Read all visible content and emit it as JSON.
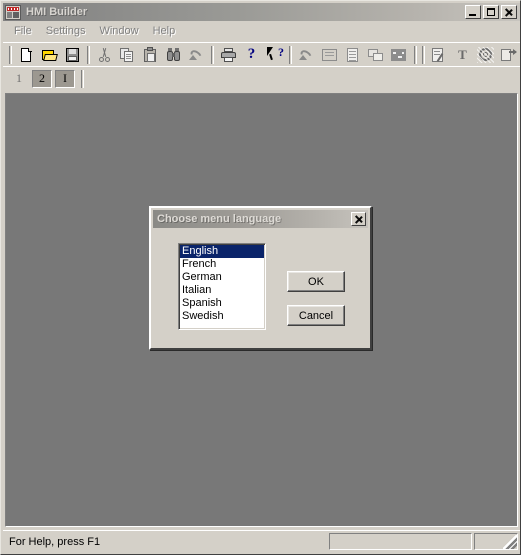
{
  "window": {
    "title": "HMI Builder",
    "icon": "hmi-builder-app-icon",
    "controls": {
      "minimize": "minimize-button",
      "maximize": "maximize-button",
      "close": "close-button"
    }
  },
  "menubar": {
    "items": [
      {
        "label": "File"
      },
      {
        "label": "Settings"
      },
      {
        "label": "Window"
      },
      {
        "label": "Help"
      }
    ]
  },
  "toolbar": {
    "groups": [
      {
        "buttons": [
          {
            "icon": "new-document-icon",
            "name": "new-button"
          },
          {
            "icon": "open-folder-icon",
            "name": "open-button"
          },
          {
            "icon": "save-floppy-icon",
            "name": "save-button"
          }
        ]
      },
      {
        "buttons": [
          {
            "icon": "scissors-icon",
            "name": "cut-button"
          },
          {
            "icon": "copy-icon",
            "name": "copy-button"
          },
          {
            "icon": "paste-clipboard-icon",
            "name": "paste-button"
          },
          {
            "icon": "binoculars-find-icon",
            "name": "find-button"
          },
          {
            "icon": "undo-arrow-icon",
            "name": "undo-button"
          }
        ]
      },
      {
        "buttons": [
          {
            "icon": "printer-icon",
            "name": "print-button"
          },
          {
            "icon": "question-mark-icon",
            "name": "help-button"
          },
          {
            "icon": "arrow-question-icon",
            "name": "context-help-button"
          }
        ]
      },
      {
        "buttons": [
          {
            "icon": "connect-nodes-icon",
            "name": "link-button"
          },
          {
            "icon": "new-frame-icon",
            "name": "new-frame-button"
          },
          {
            "icon": "document-lines-icon",
            "name": "block-list-button"
          },
          {
            "icon": "cascade-windows-icon",
            "name": "window-arrange-button"
          },
          {
            "icon": "bitmap-image-icon",
            "name": "image-button"
          }
        ]
      },
      {
        "buttons": [
          {
            "icon": "edit-note-icon",
            "name": "edit-note-button"
          },
          {
            "icon": "text-tool-icon",
            "name": "text-tool-button"
          },
          {
            "icon": "gear-settings-icon",
            "name": "settings-button"
          },
          {
            "icon": "export-icon",
            "name": "export-button"
          },
          {
            "icon": "import-icon",
            "name": "import-button"
          }
        ]
      }
    ]
  },
  "modebar": {
    "buttons": [
      {
        "label": "1",
        "state": "flat",
        "name": "mode-button-1"
      },
      {
        "label": "2",
        "state": "pressed",
        "name": "mode-button-2"
      },
      {
        "label": "I",
        "state": "pressed",
        "name": "mode-button-text"
      }
    ]
  },
  "dialog": {
    "title": "Choose menu language",
    "close_icon": "close-icon",
    "listbox": {
      "name": "language-listbox",
      "options": [
        {
          "label": "English",
          "selected": true
        },
        {
          "label": "French",
          "selected": false
        },
        {
          "label": "German",
          "selected": false
        },
        {
          "label": "Italian",
          "selected": false
        },
        {
          "label": "Spanish",
          "selected": false
        },
        {
          "label": "Swedish",
          "selected": false
        }
      ],
      "selected_value": "English"
    },
    "ok_label": "OK",
    "cancel_label": "Cancel"
  },
  "statusbar": {
    "text": "For Help, press F1",
    "pane1": "",
    "pane2": ""
  },
  "colors": {
    "face": "#d4d0c8",
    "workspace": "#787878",
    "selection": "#0a246a",
    "title_gradient_start": "#808080",
    "title_gradient_end": "#c8c5bf",
    "folder_yellow": "#ffd700",
    "help_blue": "#000080"
  }
}
